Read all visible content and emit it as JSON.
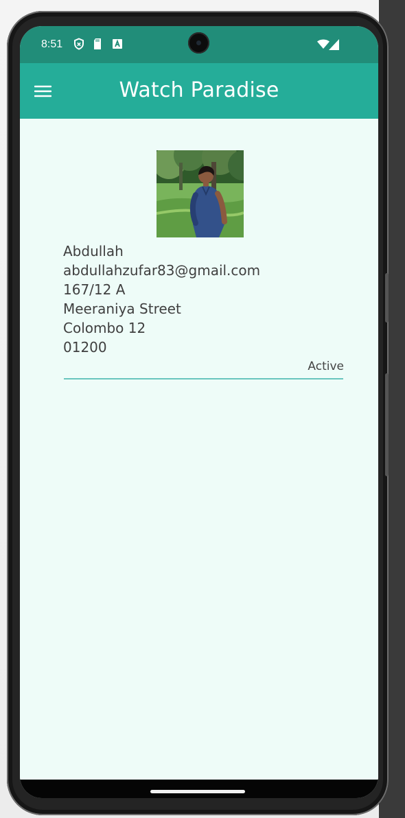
{
  "status_bar": {
    "time": "8:51",
    "icons": [
      "shield-icon",
      "sd-card-icon",
      "a-icon",
      "wifi-icon",
      "signal-icon"
    ]
  },
  "app_bar": {
    "title": "Watch Paradise",
    "menu_icon": "hamburger-menu-icon"
  },
  "profile": {
    "name": "Abdullah",
    "email": "abdullahzufar83@gmail.com",
    "address_line1": "167/12 A",
    "address_line2": "Meeraniya Street",
    "city": "Colombo 12",
    "postal_code": "01200",
    "status": "Active"
  },
  "colors": {
    "status_bar": "#218d79",
    "app_bar": "#25ad99",
    "background": "#eefcf8",
    "divider": "#68c5bd"
  }
}
